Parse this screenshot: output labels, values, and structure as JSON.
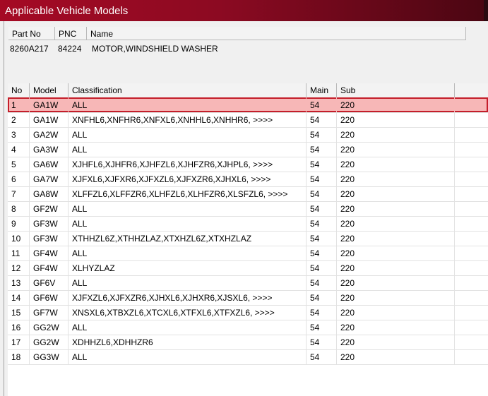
{
  "window": {
    "title": "Applicable Vehicle Models"
  },
  "part_info": {
    "headers": {
      "part_no": "Part No",
      "pnc": "PNC",
      "name": "Name"
    },
    "values": {
      "part_no": "8260A217",
      "pnc": "84224",
      "name": "MOTOR,WINDSHIELD WASHER"
    }
  },
  "models_table": {
    "headers": {
      "no": "No",
      "model": "Model",
      "classification": "Classification",
      "main": "Main",
      "sub": "Sub"
    },
    "selected_row": 0,
    "rows": [
      {
        "no": "1",
        "model": "GA1W",
        "classification": "ALL",
        "main": "54",
        "sub": "220"
      },
      {
        "no": "2",
        "model": "GA1W",
        "classification": "XNFHL6,XNFHR6,XNFXL6,XNHHL6,XNHHR6,  >>>>",
        "main": "54",
        "sub": "220"
      },
      {
        "no": "3",
        "model": "GA2W",
        "classification": "ALL",
        "main": "54",
        "sub": "220"
      },
      {
        "no": "4",
        "model": "GA3W",
        "classification": "ALL",
        "main": "54",
        "sub": "220"
      },
      {
        "no": "5",
        "model": "GA6W",
        "classification": "XJHFL6,XJHFR6,XJHFZL6,XJHFZR6,XJHPL6,  >>>>",
        "main": "54",
        "sub": "220"
      },
      {
        "no": "6",
        "model": "GA7W",
        "classification": "XJFXL6,XJFXR6,XJFXZL6,XJFXZR6,XJHXL6,  >>>>",
        "main": "54",
        "sub": "220"
      },
      {
        "no": "7",
        "model": "GA8W",
        "classification": "XLFFZL6,XLFFZR6,XLHFZL6,XLHFZR6,XLSFZL6,  >>>>",
        "main": "54",
        "sub": "220"
      },
      {
        "no": "8",
        "model": "GF2W",
        "classification": "ALL",
        "main": "54",
        "sub": "220"
      },
      {
        "no": "9",
        "model": "GF3W",
        "classification": "ALL",
        "main": "54",
        "sub": "220"
      },
      {
        "no": "10",
        "model": "GF3W",
        "classification": "XTHHZL6Z,XTHHZLAZ,XTXHZL6Z,XTXHZLAZ",
        "main": "54",
        "sub": "220"
      },
      {
        "no": "11",
        "model": "GF4W",
        "classification": "ALL",
        "main": "54",
        "sub": "220"
      },
      {
        "no": "12",
        "model": "GF4W",
        "classification": "XLHYZLAZ",
        "main": "54",
        "sub": "220"
      },
      {
        "no": "13",
        "model": "GF6V",
        "classification": "ALL",
        "main": "54",
        "sub": "220"
      },
      {
        "no": "14",
        "model": "GF6W",
        "classification": "XJFXZL6,XJFXZR6,XJHXL6,XJHXR6,XJSXL6,  >>>>",
        "main": "54",
        "sub": "220"
      },
      {
        "no": "15",
        "model": "GF7W",
        "classification": "XNSXL6,XTBXZL6,XTCXL6,XTFXL6,XTFXZL6,  >>>>",
        "main": "54",
        "sub": "220"
      },
      {
        "no": "16",
        "model": "GG2W",
        "classification": "ALL",
        "main": "54",
        "sub": "220"
      },
      {
        "no": "17",
        "model": "GG2W",
        "classification": "XDHHZL6,XDHHZR6",
        "main": "54",
        "sub": "220"
      },
      {
        "no": "18",
        "model": "GG3W",
        "classification": "ALL",
        "main": "54",
        "sub": "220"
      }
    ]
  }
}
